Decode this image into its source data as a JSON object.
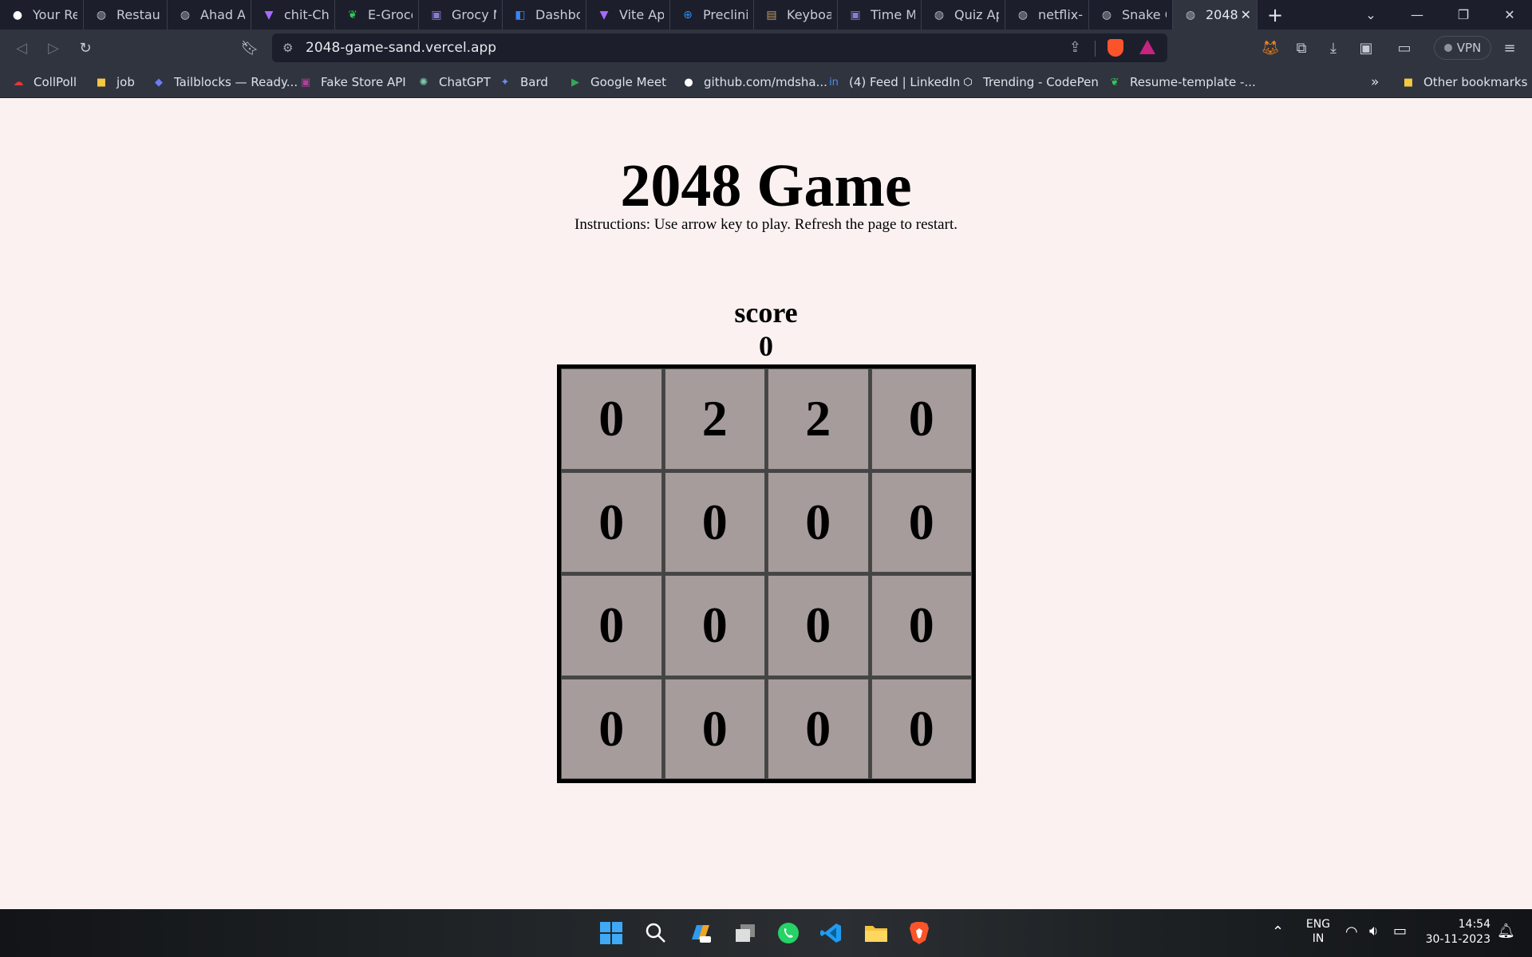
{
  "browser": {
    "tabs": [
      {
        "label": "Your Rep",
        "icon": "github-icon"
      },
      {
        "label": "Restaura",
        "icon": "globe-icon"
      },
      {
        "label": "Ahad Ap",
        "icon": "globe-icon"
      },
      {
        "label": "chit-Chat",
        "icon": "vite-icon"
      },
      {
        "label": "E-Grocer",
        "icon": "leaf-icon"
      },
      {
        "label": "Grocy M",
        "icon": "app-icon"
      },
      {
        "label": "Dashboa",
        "icon": "map-icon"
      },
      {
        "label": "Vite App",
        "icon": "vite-icon"
      },
      {
        "label": "Preclinic",
        "icon": "plus-circle-icon"
      },
      {
        "label": "Keyboar",
        "icon": "scroll-icon"
      },
      {
        "label": "Time Ma",
        "icon": "app-icon"
      },
      {
        "label": "Quiz App",
        "icon": "globe-icon"
      },
      {
        "label": "netflix-d",
        "icon": "globe-icon"
      },
      {
        "label": "Snake Ga",
        "icon": "globe-icon"
      },
      {
        "label": "2048",
        "icon": "globe-icon",
        "active": true
      }
    ],
    "address": "2048-game-sand.vercel.app",
    "vpn_label": "VPN",
    "bookmarks": [
      {
        "label": "CollPoll",
        "icon": "collpoll-icon"
      },
      {
        "label": "job",
        "icon": "folder-icon"
      },
      {
        "label": "Tailblocks — Ready...",
        "icon": "tailblocks-icon"
      },
      {
        "label": "Fake Store API",
        "icon": "store-icon"
      },
      {
        "label": "ChatGPT",
        "icon": "chatgpt-icon"
      },
      {
        "label": "Bard",
        "icon": "bard-icon"
      },
      {
        "label": "Google Meet",
        "icon": "meet-icon"
      },
      {
        "label": "github.com/mdsha...",
        "icon": "github-icon"
      },
      {
        "label": "(4) Feed | LinkedIn",
        "icon": "linkedin-icon"
      },
      {
        "label": "Trending - CodePen",
        "icon": "codepen-icon"
      },
      {
        "label": "Resume-template -...",
        "icon": "leaf-icon"
      }
    ],
    "more_bookmarks": "»",
    "other_bookmarks": "Other bookmarks"
  },
  "game": {
    "title": "2048 Game",
    "instructions": "Instructions: Use arrow key to play. Refresh the page to restart.",
    "score_label": "score",
    "score_value": "0",
    "board": [
      [
        "0",
        "2",
        "2",
        "0"
      ],
      [
        "0",
        "0",
        "0",
        "0"
      ],
      [
        "0",
        "0",
        "0",
        "0"
      ],
      [
        "0",
        "0",
        "0",
        "0"
      ]
    ]
  },
  "taskbar": {
    "lang_top": "ENG",
    "lang_bottom": "IN",
    "time": "14:54",
    "date": "30-11-2023"
  },
  "colors": {
    "page_bg": "#fbf1f1",
    "tile_bg": "#a59c9b",
    "board_border": "#000000"
  }
}
